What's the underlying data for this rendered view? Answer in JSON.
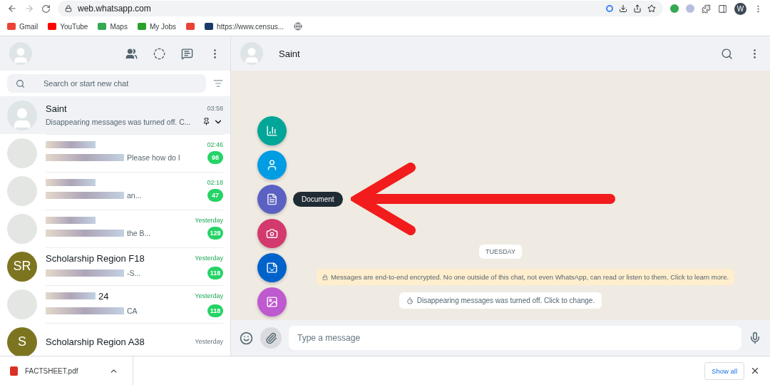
{
  "browser": {
    "url": "web.whatsapp.com",
    "profile_initial": "W",
    "bookmarks": [
      {
        "kind": "gmail",
        "label": "Gmail"
      },
      {
        "kind": "youtube",
        "label": "YouTube"
      },
      {
        "kind": "maps",
        "label": "Maps"
      },
      {
        "kind": "jobs",
        "label": "My Jobs"
      },
      {
        "kind": "gmail"
      },
      {
        "kind": "cb",
        "label": "https://www.census..."
      },
      {
        "kind": "globe"
      }
    ]
  },
  "sidebar": {
    "search": {
      "placeholder": "Search or start new chat"
    },
    "chats": [
      {
        "name": "Saint",
        "preview": "Disappearing messages was turned off. C...",
        "time": "03:58",
        "pinned": true,
        "selected": true,
        "avatar": {
          "kind": "default"
        }
      },
      {
        "name_redacted": true,
        "preview_redacted": true,
        "preview": "Please how do I",
        "time": "02:46",
        "unread": "98",
        "selected": false,
        "avatar": {
          "kind": "photo"
        }
      },
      {
        "name_redacted": true,
        "preview_redacted": true,
        "preview": "an...",
        "time": "02:18",
        "unread": "47",
        "selected": false,
        "avatar": {
          "kind": "photo"
        }
      },
      {
        "name_redacted": true,
        "preview_redacted": true,
        "preview": "the B...",
        "time": "Yesterday",
        "unread": "128",
        "selected": false,
        "avatar": {
          "kind": "photo"
        }
      },
      {
        "name": "Scholarship Region F18",
        "preview_redacted": true,
        "preview": "-S...",
        "time": "Yesterday",
        "unread": "118",
        "selected": false,
        "avatar": {
          "kind": "initials",
          "initials": "SR"
        }
      },
      {
        "name": "24",
        "name_redacted": true,
        "preview_redacted": true,
        "preview": "CA",
        "time": "Yesterday",
        "unread": "118",
        "selected": false,
        "avatar": {
          "kind": "photo"
        }
      },
      {
        "name": "Scholarship Region A38",
        "time": "Yesterday",
        "selected": false,
        "avatar": {
          "kind": "initials",
          "initials": "S"
        }
      }
    ]
  },
  "conversation": {
    "contact": "Saint",
    "attach_menu": [
      {
        "kind": "poll",
        "selected": false
      },
      {
        "kind": "contact",
        "selected": false
      },
      {
        "kind": "document",
        "selected": true,
        "tooltip": "Document"
      },
      {
        "kind": "camera",
        "selected": false
      },
      {
        "kind": "sticker",
        "selected": false
      },
      {
        "kind": "photos",
        "selected": false
      }
    ],
    "day": "TUESDAY",
    "encryption_notice": "Messages are end-to-end encrypted. No one outside of this chat, not even WhatsApp, can read or listen to them. Click to learn more.",
    "system_message": "Disappearing messages was turned off. Click to change.",
    "composer": {
      "placeholder": "Type a message"
    }
  },
  "downloads": {
    "file": "FACTSHEET.pdf",
    "show_all": "Show all"
  }
}
